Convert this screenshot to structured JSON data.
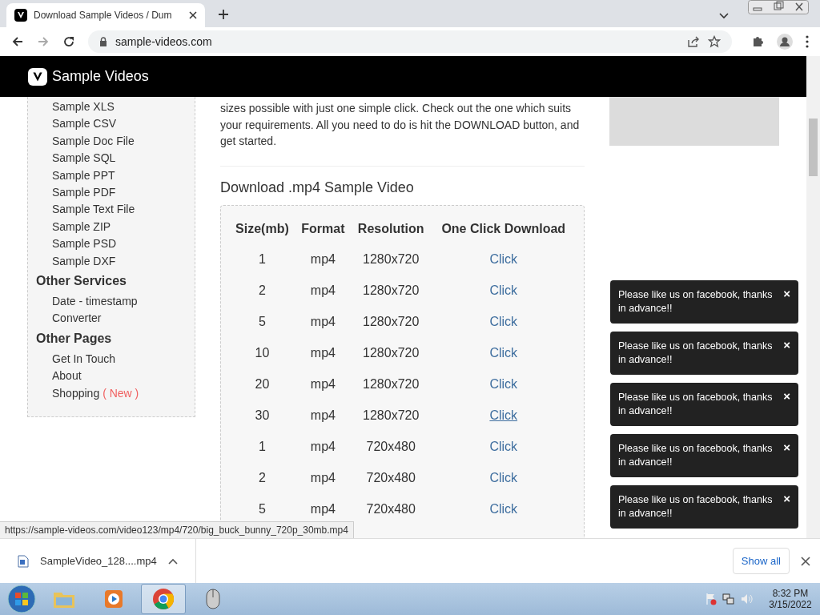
{
  "browser": {
    "tab": {
      "title": "Download Sample Videos / Dum"
    },
    "address": "sample-videos.com"
  },
  "site": {
    "brand": "Sample Videos"
  },
  "sidebar": {
    "items": [
      "Sample XLS",
      "Sample CSV",
      "Sample Doc File",
      "Sample SQL",
      "Sample PPT",
      "Sample PDF",
      "Sample Text File",
      "Sample ZIP",
      "Sample PSD",
      "Sample DXF"
    ],
    "sections": [
      {
        "title": "Other Services",
        "items": [
          {
            "label": "Date - timestamp Converter"
          }
        ]
      },
      {
        "title": "Other Pages",
        "items": [
          {
            "label": "Get In Touch"
          },
          {
            "label": "About"
          },
          {
            "label": "Shopping",
            "badge": "( New )"
          }
        ]
      }
    ]
  },
  "intro": "sizes possible with just one simple click. Check out the one which suits your requirements. All you need to do is hit the DOWNLOAD button, and get started.",
  "section_title": "Download .mp4 Sample Video",
  "table": {
    "columns": [
      "Size(mb)",
      "Format",
      "Resolution",
      "One Click Download"
    ],
    "rows": [
      {
        "cells": [
          "1",
          "mp4",
          "1280x720",
          "Click"
        ],
        "hovered": false
      },
      {
        "cells": [
          "2",
          "mp4",
          "1280x720",
          "Click"
        ],
        "hovered": false
      },
      {
        "cells": [
          "5",
          "mp4",
          "1280x720",
          "Click"
        ],
        "hovered": false
      },
      {
        "cells": [
          "10",
          "mp4",
          "1280x720",
          "Click"
        ],
        "hovered": false
      },
      {
        "cells": [
          "20",
          "mp4",
          "1280x720",
          "Click"
        ],
        "hovered": false
      },
      {
        "cells": [
          "30",
          "mp4",
          "1280x720",
          "Click"
        ],
        "hovered": true
      },
      {
        "cells": [
          "1",
          "mp4",
          "720x480",
          "Click"
        ],
        "hovered": false
      },
      {
        "cells": [
          "2",
          "mp4",
          "720x480",
          "Click"
        ],
        "hovered": false
      },
      {
        "cells": [
          "5",
          "mp4",
          "720x480",
          "Click"
        ],
        "hovered": false
      }
    ]
  },
  "toasts": [
    {
      "text": "Please like us on facebook, thanks in advance!!",
      "close": "×"
    },
    {
      "text": "Please like us on facebook, thanks in advance!!",
      "close": "×"
    },
    {
      "text": "Please like us on facebook, thanks in advance!!",
      "close": "×"
    },
    {
      "text": "Please like us on facebook, thanks in advance!!",
      "close": "×"
    },
    {
      "text": "Please like us on facebook, thanks in advance!!",
      "close": "×"
    }
  ],
  "status_url": "https://sample-videos.com/video123/mp4/720/big_buck_bunny_720p_30mb.mp4",
  "download_shelf": {
    "file": "SampleVideo_128....mp4",
    "show_all": "Show all"
  },
  "taskbar": {
    "time": "8:32 PM",
    "date": "3/15/2022"
  }
}
